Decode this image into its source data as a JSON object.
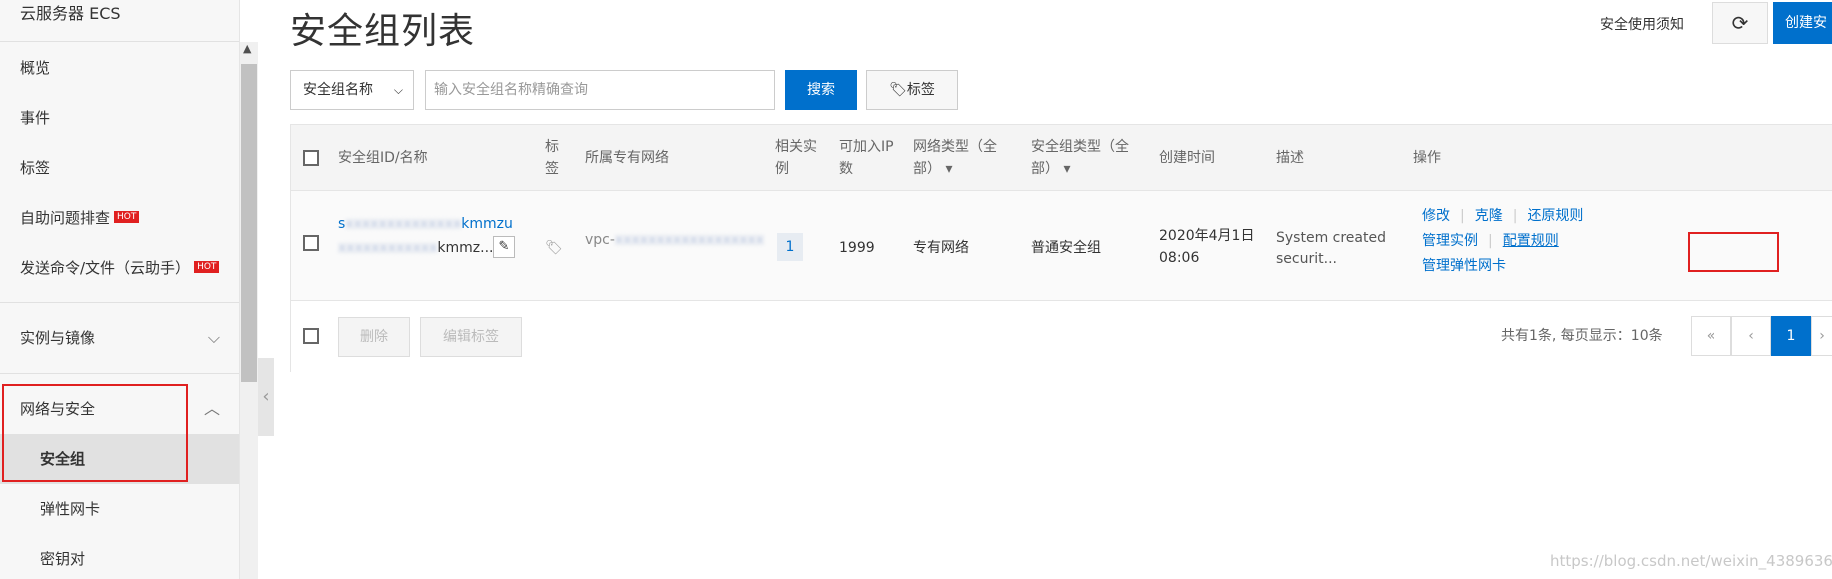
{
  "sidebar": {
    "title": "云服务器 ECS",
    "items": [
      {
        "label": "概览"
      },
      {
        "label": "事件"
      },
      {
        "label": "标签"
      },
      {
        "label": "自助问题排查",
        "badge": "HOT"
      },
      {
        "label": "发送命令/文件（云助手）",
        "badge": "HOT"
      }
    ],
    "groups": [
      {
        "label": "实例与镜像",
        "chevron": "chevron-down-icon"
      },
      {
        "label": "网络与安全",
        "chevron": "chevron-up-icon"
      }
    ],
    "sub_items": [
      {
        "label": "安全组",
        "active": true
      },
      {
        "label": "弹性网卡"
      },
      {
        "label": "密钥对"
      }
    ]
  },
  "header": {
    "title": "安全组列表",
    "notice": "安全使用须知",
    "refresh_icon": "refresh-icon",
    "create_label": "创建安"
  },
  "search": {
    "select_value": "安全组名称",
    "placeholder": "输入安全组名称精确查询",
    "button": "搜索",
    "tag_button": "标签"
  },
  "table": {
    "headers": {
      "id_name": "安全组ID/名称",
      "tag": "标签",
      "vpc": "所属专有网络",
      "instances": "相关实例",
      "ip_count": "可加入IP数",
      "net_type": "网络类型（全部）",
      "sg_type": "安全组类型（全部）",
      "created": "创建时间",
      "desc": "描述",
      "ops": "操作"
    },
    "row": {
      "id_line1_a": "s",
      "id_line1_b": "kmmzu",
      "id_line2": "kmmz...",
      "vpc": "vpc-",
      "instances": "1",
      "ip_count": "1999",
      "net_type": "专有网络",
      "sg_type": "普通安全组",
      "created_date": "2020年4月1日",
      "created_time": "08:06",
      "desc_line1": "System created",
      "desc_line2": "securit...",
      "ops": {
        "modify": "修改",
        "clone": "克隆",
        "restore": "还原规则",
        "manage_instances": "管理实例",
        "configure_rules": "配置规则",
        "manage_eni": "管理弹性网卡"
      }
    }
  },
  "footer": {
    "delete": "删除",
    "edit_tags": "编辑标签",
    "pager_info": "共有1条, 每页显示：10条",
    "first": "«",
    "prev": "‹",
    "page": "1",
    "next": "›"
  },
  "watermark": "https://blog.csdn.net/weixin_43896364"
}
